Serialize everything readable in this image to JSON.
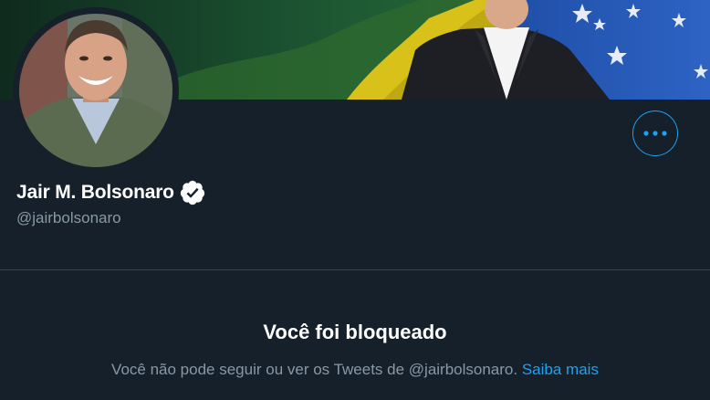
{
  "colors": {
    "background": "#15202b",
    "accent": "#1da1f2",
    "primary_text": "#ffffff",
    "secondary_text": "#8899a6",
    "divider": "#38444d"
  },
  "profile": {
    "name": "Jair M. Bolsonaro",
    "handle": "@jairbolsonaro",
    "verified": true,
    "verified_icon": "verified-badge-icon",
    "more_icon": "more-options-icon"
  },
  "blocked": {
    "title": "Você foi bloqueado",
    "message": "Você não pode seguir ou ver os Tweets de @jairbolsonaro.",
    "link_label": "Saiba mais"
  }
}
